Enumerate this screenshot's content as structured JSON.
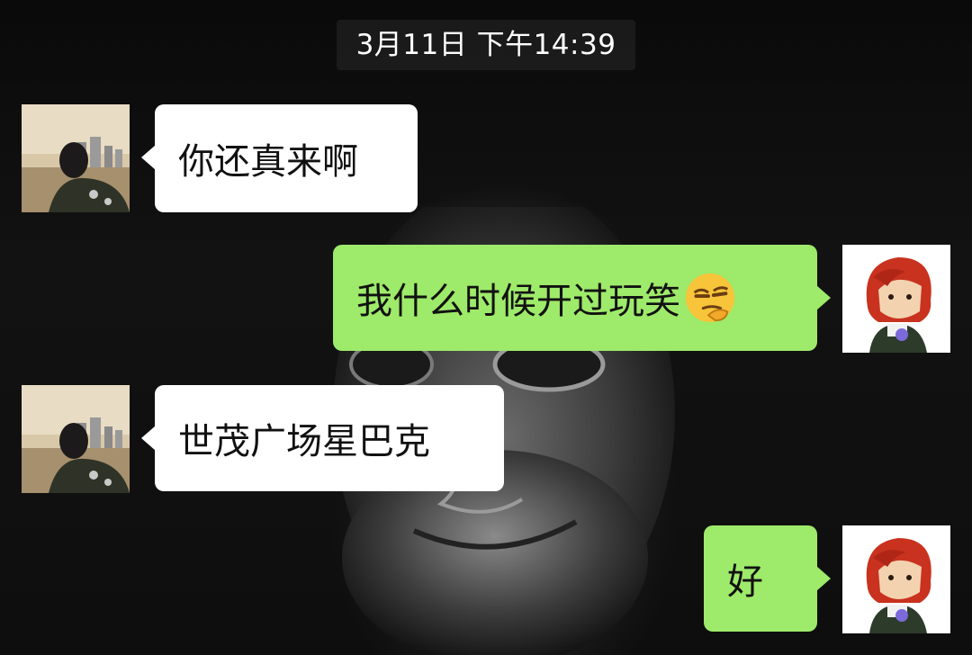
{
  "chat": {
    "timestamp": "3月11日 下午14:39",
    "messages": [
      {
        "side": "incoming",
        "text": "你还真来啊"
      },
      {
        "side": "outgoing",
        "text": "我什么时候开过玩笑",
        "emoji": "thinking-face-emoji"
      },
      {
        "side": "incoming",
        "text": "世茂广场星巴克"
      },
      {
        "side": "outgoing",
        "text": "好"
      }
    ]
  },
  "colors": {
    "incoming_bubble": "#ffffff",
    "outgoing_bubble": "#9eea6a",
    "background": "#0d0d0d"
  }
}
